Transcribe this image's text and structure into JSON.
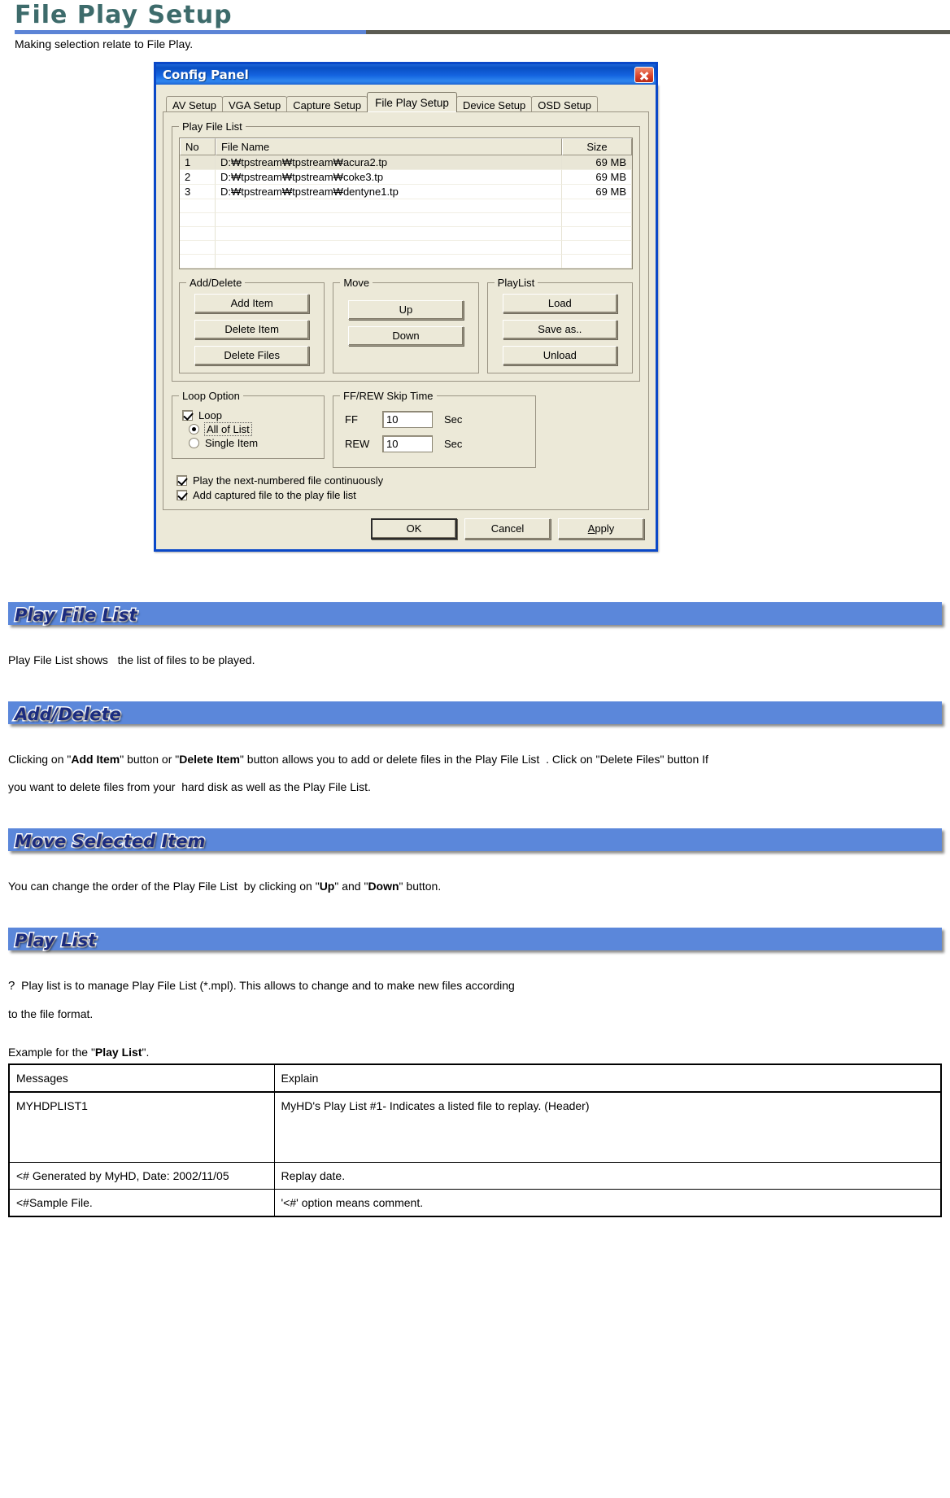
{
  "page": {
    "title": "File Play Setup",
    "intro": "Making selection relate to File Play."
  },
  "dialog": {
    "title": "Config Panel",
    "close_icon": "close-icon",
    "tabs": [
      {
        "label": "AV Setup",
        "active": false
      },
      {
        "label": "VGA Setup",
        "active": false
      },
      {
        "label": "Capture Setup",
        "active": false
      },
      {
        "label": "File Play Setup",
        "active": true
      },
      {
        "label": "Device Setup",
        "active": false
      },
      {
        "label": "OSD Setup",
        "active": false
      }
    ],
    "play_file_list": {
      "legend": "Play File List",
      "columns": [
        "No",
        "File Name",
        "Size"
      ],
      "rows": [
        {
          "no": "1",
          "name": "D:₩tpstream₩tpstream₩acura2.tp",
          "size": "69 MB",
          "selected": true
        },
        {
          "no": "2",
          "name": "D:₩tpstream₩tpstream₩coke3.tp",
          "size": "69 MB",
          "selected": false
        },
        {
          "no": "3",
          "name": "D:₩tpstream₩tpstream₩dentyne1.tp",
          "size": "69 MB",
          "selected": false
        }
      ],
      "empty_rows": 5
    },
    "add_delete": {
      "legend": "Add/Delete",
      "add_item": "Add Item",
      "delete_item": "Delete Item",
      "delete_files": "Delete Files"
    },
    "move": {
      "legend": "Move",
      "up": "Up",
      "down": "Down"
    },
    "playlist": {
      "legend": "PlayList",
      "load": "Load",
      "save_as": "Save as..",
      "unload": "Unload"
    },
    "loop_option": {
      "legend": "Loop Option",
      "loop": {
        "label": "Loop",
        "checked": true
      },
      "all_of_list": {
        "label": "All of List",
        "selected": true
      },
      "single_item": {
        "label": "Single Item",
        "selected": false
      }
    },
    "skip_time": {
      "legend": "FF/REW Skip Time",
      "ff_label": "FF",
      "ff_value": "10",
      "ff_unit": "Sec",
      "rew_label": "REW",
      "rew_value": "10",
      "rew_unit": "Sec"
    },
    "footer_checks": [
      {
        "label": "Play the next-numbered file continuously",
        "checked": true
      },
      {
        "label": "Add captured file to the play file list",
        "checked": true
      }
    ],
    "buttons": {
      "ok": "OK",
      "cancel": "Cancel",
      "apply": "Apply"
    }
  },
  "sections": [
    {
      "banner": "Play File List",
      "body_html": "Play File List shows &nbsp; the list of files to be played."
    },
    {
      "banner": "Add/Delete",
      "body_html": "Clicking on \"<b>Add Item</b>\" button or \"<b>Delete Item</b>\" button allows you to add or delete files in the Play File List &nbsp;. Click on \"Delete Files\" button If<br>you want to delete files from your &nbsp;hard disk as well as the Play File List."
    },
    {
      "banner": "Move Selected Item",
      "body_html": "You can change the order of the Play File List &nbsp;by clicking on \"<b>Up</b>\" and \"<b>Down</b>\" button."
    },
    {
      "banner": "Play List",
      "body_html": "<span class=\"qmark\">?</span>&nbsp; Play list is to manage Play File List (*.mpl). This allows to change and to make new files according<br>to the file format."
    }
  ],
  "example": {
    "lead_html": "Example for the \"<b>Play List</b>\".",
    "columns": [
      "Messages",
      "Explain"
    ],
    "rows": [
      {
        "message": "MYHDPLIST1",
        "explain": "MyHD's Play List #1- Indicates a listed file to replay. (Header)",
        "tall": true
      },
      {
        "message": "<# Generated by MyHD, Date: 2002/11/05",
        "explain": "Replay date.",
        "tall": false
      },
      {
        "message": "<#Sample File.",
        "explain": "'<#' option means  comment.",
        "tall": false
      }
    ]
  }
}
